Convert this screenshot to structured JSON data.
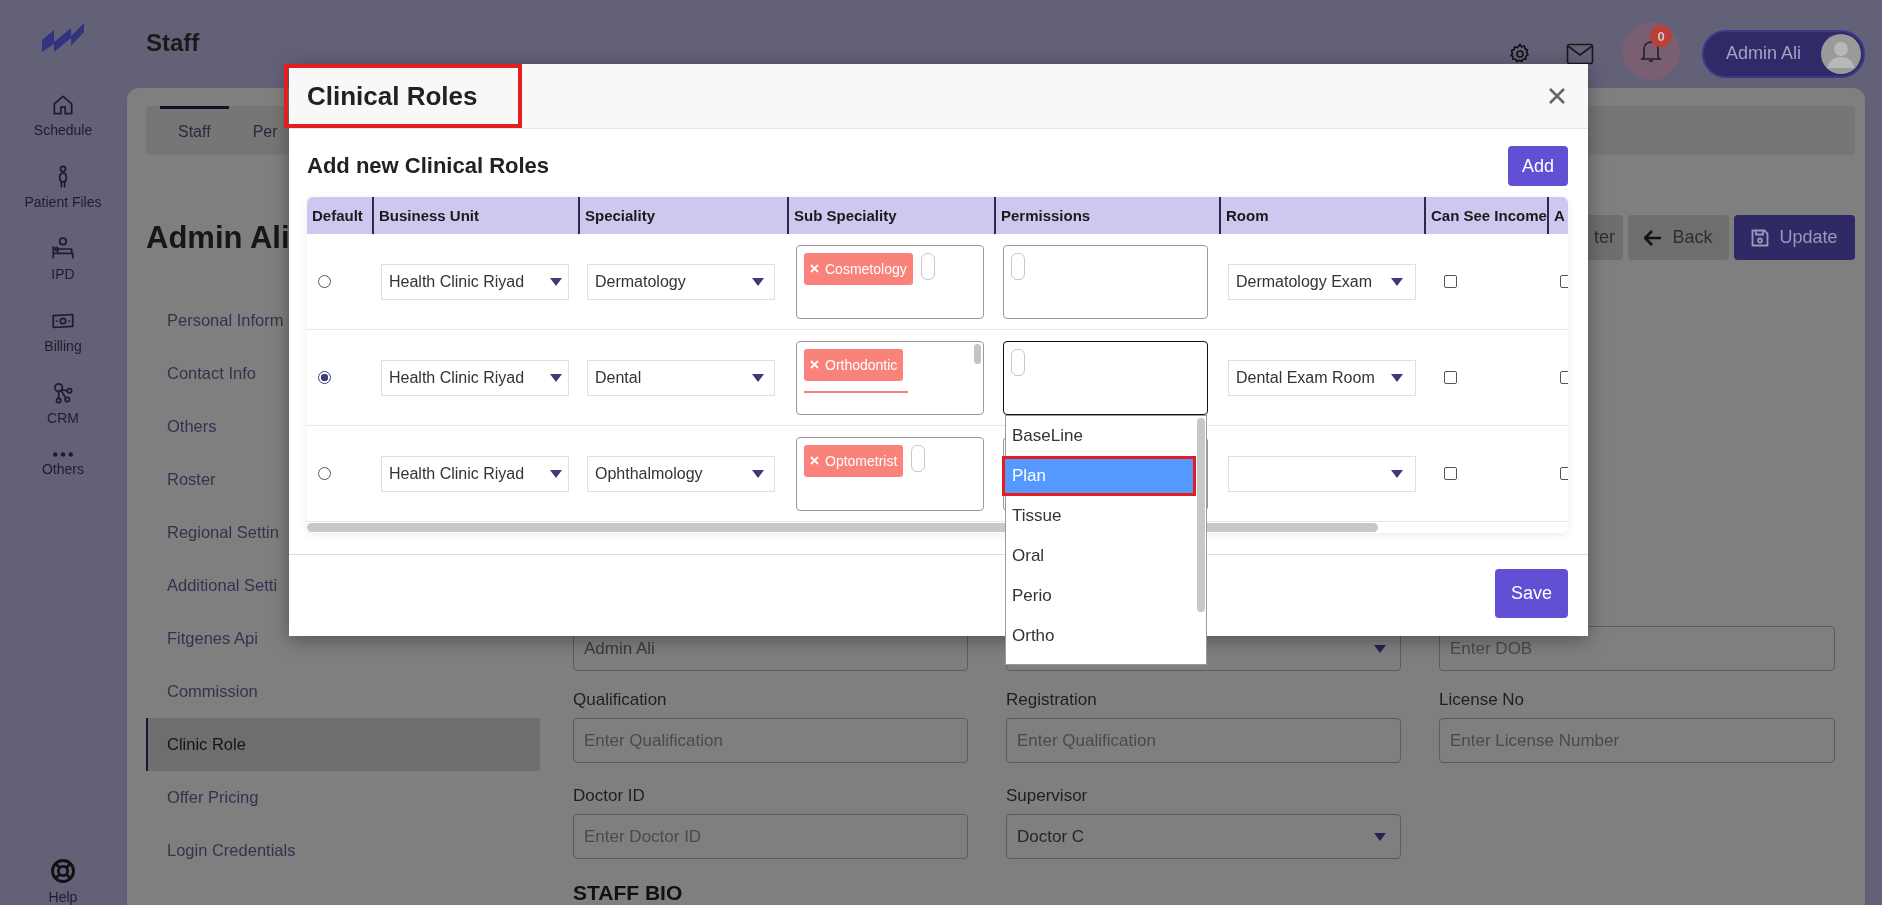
{
  "nav": {
    "items": [
      {
        "label": "Schedule"
      },
      {
        "label": "Patient Files"
      },
      {
        "label": "IPD"
      },
      {
        "label": "Billing"
      },
      {
        "label": "CRM"
      },
      {
        "label": "Others"
      }
    ],
    "help": "Help"
  },
  "header": {
    "title": "Staff",
    "notification_count": "0",
    "user_name": "Admin Ali"
  },
  "page": {
    "tabs": [
      {
        "label": "Staff",
        "selected": true
      },
      {
        "label": "Per",
        "selected": false
      }
    ],
    "heading": "Admin Ali",
    "actions": [
      {
        "label": "ter",
        "kind": "plain"
      },
      {
        "label": "Back",
        "kind": "back"
      },
      {
        "label": "Update",
        "kind": "save"
      }
    ],
    "menu": [
      {
        "label": "Personal Inform",
        "selected": false
      },
      {
        "label": "Contact Info",
        "selected": false
      },
      {
        "label": "Others",
        "selected": false
      },
      {
        "label": "Roster",
        "selected": false
      },
      {
        "label": "Regional Settin",
        "selected": false
      },
      {
        "label": "Additional Setti",
        "selected": false
      },
      {
        "label": "Fitgenes Api",
        "selected": false
      },
      {
        "label": "Commission",
        "selected": false
      },
      {
        "label": "Clinic Role",
        "selected": true
      },
      {
        "label": "Offer Pricing",
        "selected": false
      },
      {
        "label": "Login Credentials",
        "selected": false
      }
    ],
    "form_rows": [
      [
        {
          "kind": "input",
          "value": "Admin Ali"
        },
        {
          "kind": "select"
        },
        {
          "kind": "input",
          "placeholder": "Enter DOB"
        }
      ],
      [
        {
          "kind": "input",
          "label": "Qualification",
          "placeholder": "Enter Qualification"
        },
        {
          "kind": "input",
          "label": "Registration",
          "placeholder": "Enter Qualification"
        },
        {
          "kind": "input",
          "label": "License No",
          "placeholder": "Enter License Number"
        }
      ],
      [
        {
          "kind": "input",
          "label": "Doctor ID",
          "placeholder": "Enter Doctor ID"
        },
        {
          "kind": "select",
          "label": "Supervisor",
          "value": "Doctor C"
        }
      ]
    ],
    "section_heading": "STAFF BIO"
  },
  "modal": {
    "title": "Clinical Roles",
    "title_highlighted": true,
    "subtitle": "Add new Clinical Roles",
    "add_button": "Add",
    "columns": [
      "Default",
      "Business Unit",
      "Speciality",
      "Sub Speciality",
      "Permissions",
      "Room",
      "Can See Income",
      "A"
    ],
    "rows": [
      {
        "default": false,
        "business_unit": "Health Clinic Riyad",
        "speciality": "Dermatology",
        "sub_specialities": [
          "Cosmetology"
        ],
        "more_below": false,
        "permissions_focused": false,
        "room": "Dermatology Exam",
        "can_see_income": false,
        "column_8": false
      },
      {
        "default": true,
        "business_unit": "Health Clinic Riyad",
        "speciality": "Dental",
        "sub_specialities": [
          "Orthodontic"
        ],
        "more_below": true,
        "permissions_focused": true,
        "room": "Dental Exam Room",
        "can_see_income": false,
        "column_8": false
      },
      {
        "default": false,
        "business_unit": "Health Clinic Riyad",
        "speciality": "Ophthalmology",
        "sub_specialities": [
          "Optometrist"
        ],
        "more_below": false,
        "permissions_focused": false,
        "can_see_income": false,
        "column_8": false
      }
    ],
    "dropdown": {
      "options": [
        {
          "label": "BaseLine",
          "selected": false,
          "highlighted": false
        },
        {
          "label": "Plan",
          "selected": true,
          "highlighted": true
        },
        {
          "label": "Tissue",
          "selected": false,
          "highlighted": false
        },
        {
          "label": "Oral",
          "selected": false,
          "highlighted": false
        },
        {
          "label": "Perio",
          "selected": false,
          "highlighted": false
        },
        {
          "label": "Ortho",
          "selected": false,
          "highlighted": false
        }
      ]
    },
    "save_button": "Save"
  }
}
